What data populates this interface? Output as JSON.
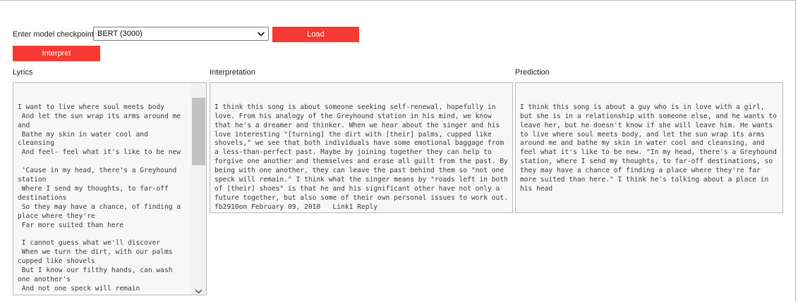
{
  "controls": {
    "checkpoint_label": "Enter model checkpoint",
    "checkpoint_value": "BERT (3000)",
    "load_label": "Load",
    "interpret_label": "Interpret"
  },
  "panels": {
    "lyrics_label": "Lyrics",
    "lyrics_text": "I want to live where soul meets body\n And let the sun wrap its arms around me and\n Bathe my skin in water cool and cleansing\n And feel- feel what it's like to be new\n\n 'Cause in my head, there's a Greyhound station\n Where I send my thoughts, to far-off destinations\n So they may have a chance, of finding a place where they're\n Far more suited than here\n\n I cannot guess what we'll discover\n When we turn the dirt, with our palms cupped like shovels\n But I know our filthy hands, can wash one another's\n And not one speck will remain",
    "interpretation_label": "Interpretation",
    "interpretation_text": "I think this song is about someone seeking self-renewal, hopefully in love. From his analogy of the Greyhound station in his mind, we know that he's a dreamer and thinker. When we hear about the singer and his love interesting \"[turning] the dirt with [their] palms, cupped like shovels,\" we see that both individuals have some emotional baggage from a less-than-perfect past. Maybe by joining together they can help to forgive one another and themselves and erase all guilt from the past. By being with one another, they can leave the past behind them so \"not one speck will remain.\" I think what the singer means by \"roads left in both of [their] shoes\" is that he and his significant other have not only a future together, but also some of their own personal issues to work out. fb2910on February 09, 2010   Link1 Reply",
    "prediction_label": "Prediction",
    "prediction_text": "I think this song is about a guy who is in love with a girl, but she is in a relationship with someone else, and he wants to leave her, but he doesn't know if she will leave him. He wants to live where soul meets body, and let the sun wrap its arms around me and bathe my skin in water cool and cleansing, and feel what it's like to be new. \"In my head, there's a Greyhound station, where I send my thoughts, to far-off destinations, so they may have a chance of finding a place where they're far more suited than here.\" I think he's talking about a place in his head"
  },
  "icons": {
    "select_arrow": "chevron-down-icon",
    "scroll_up": "scroll-up-arrow-icon",
    "scroll_down": "scroll-down-arrow-icon",
    "resize": "resize-grip-icon"
  },
  "colors": {
    "accent": "#f43a33",
    "textarea_bg": "#f7f7f7"
  }
}
